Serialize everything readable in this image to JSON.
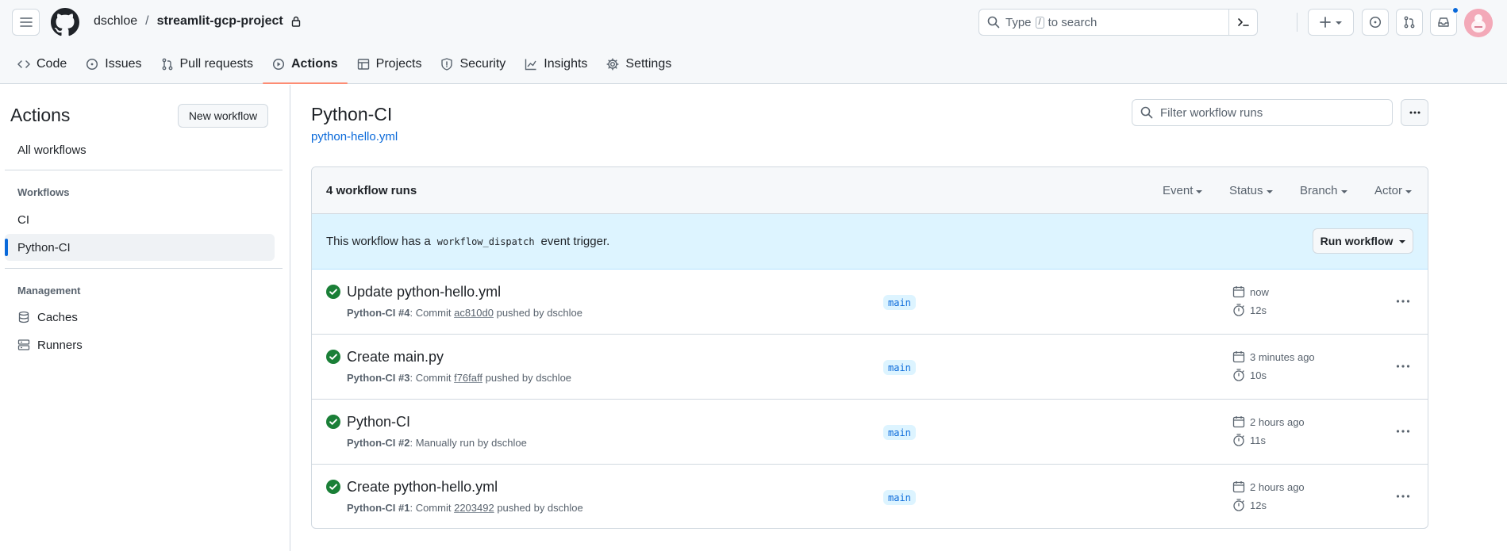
{
  "header": {
    "owner": "dschloe",
    "separator": "/",
    "repo": "streamlit-gcp-project",
    "search_prefix": "Type",
    "search_key": "/",
    "search_suffix": "to search"
  },
  "nav": [
    {
      "label": "Code",
      "icon": "code-icon"
    },
    {
      "label": "Issues",
      "icon": "issue-icon"
    },
    {
      "label": "Pull requests",
      "icon": "pull-request-icon"
    },
    {
      "label": "Actions",
      "icon": "play-icon",
      "active": true
    },
    {
      "label": "Projects",
      "icon": "table-icon"
    },
    {
      "label": "Security",
      "icon": "shield-icon"
    },
    {
      "label": "Insights",
      "icon": "graph-icon"
    },
    {
      "label": "Settings",
      "icon": "gear-icon"
    }
  ],
  "sidebar": {
    "title": "Actions",
    "new_workflow": "New workflow",
    "all_workflows": "All workflows",
    "workflows_heading": "Workflows",
    "workflows": [
      {
        "label": "CI"
      },
      {
        "label": "Python-CI",
        "selected": true
      }
    ],
    "management_heading": "Management",
    "management": [
      {
        "label": "Caches",
        "icon": "database-icon"
      },
      {
        "label": "Runners",
        "icon": "server-icon"
      }
    ]
  },
  "main": {
    "title": "Python-CI",
    "file": "python-hello.yml",
    "filter_placeholder": "Filter workflow runs",
    "runs_count": "4 workflow runs",
    "filters": [
      "Event",
      "Status",
      "Branch",
      "Actor"
    ],
    "dispatch_prefix": "This workflow has a",
    "dispatch_code": "workflow_dispatch",
    "dispatch_suffix": "event trigger.",
    "run_workflow": "Run workflow",
    "runs": [
      {
        "title": "Update python-hello.yml",
        "workflow": "Python-CI #4",
        "meta_a": ": Commit ",
        "sha": "ac810d0",
        "meta_b": " pushed by dschloe",
        "branch": "main",
        "when": "now",
        "duration": "12s"
      },
      {
        "title": "Create main.py",
        "workflow": "Python-CI #3",
        "meta_a": ": Commit ",
        "sha": "f76faff",
        "meta_b": " pushed by dschloe",
        "branch": "main",
        "when": "3 minutes ago",
        "duration": "10s"
      },
      {
        "title": "Python-CI",
        "workflow": "Python-CI #2",
        "meta_a": ": Manually run by dschloe",
        "sha": "",
        "meta_b": "",
        "branch": "main",
        "when": "2 hours ago",
        "duration": "11s"
      },
      {
        "title": "Create python-hello.yml",
        "workflow": "Python-CI #1",
        "meta_a": ": Commit ",
        "sha": "2203492",
        "meta_b": " pushed by dschloe",
        "branch": "main",
        "when": "2 hours ago",
        "duration": "12s"
      }
    ]
  },
  "colors": {
    "accent": "#0969da",
    "success": "#1a7f37",
    "active_tab_underline": "#fd8c73",
    "dispatch_bg": "#ddf4ff"
  }
}
